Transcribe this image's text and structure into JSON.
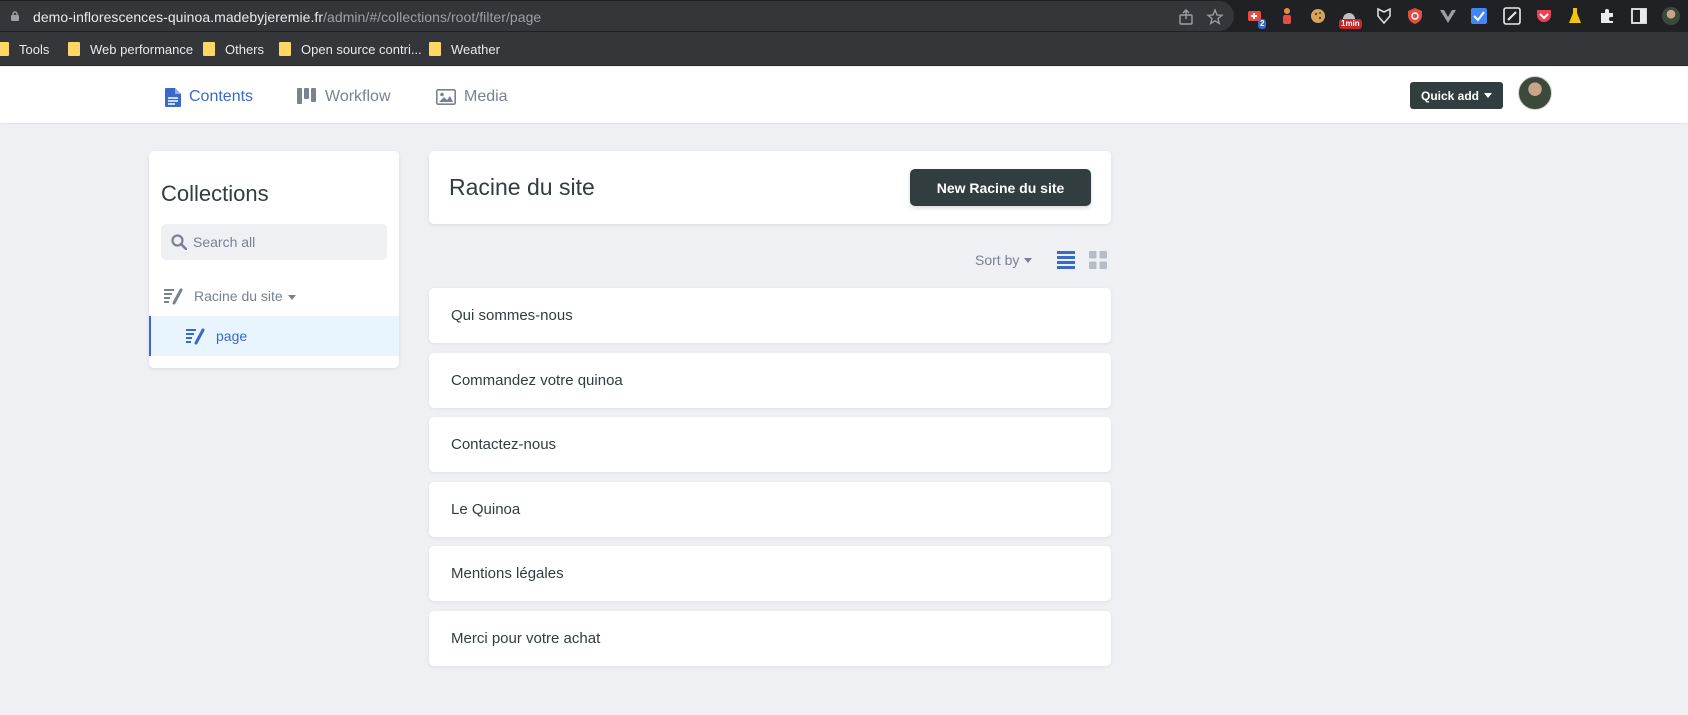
{
  "browser": {
    "url_host": "demo-inflorescences-quinoa.madebyjeremie.fr",
    "url_path": "/admin/#/collections/root/filter/page",
    "ext_badges": {
      "tab_count": "2",
      "timer": "1min"
    },
    "bookmarks": [
      "Tools",
      "Web performance",
      "Others",
      "Open source contri...",
      "Weather"
    ]
  },
  "header": {
    "nav": [
      {
        "label": "Contents",
        "icon": "document-icon",
        "active": true
      },
      {
        "label": "Workflow",
        "icon": "workflow-icon",
        "active": false
      },
      {
        "label": "Media",
        "icon": "image-icon",
        "active": false
      }
    ],
    "quick_add_label": "Quick add"
  },
  "sidebar": {
    "title": "Collections",
    "search_placeholder": "Search all",
    "collection": {
      "label": "Racine du site"
    },
    "filter": {
      "label": "page",
      "active": true
    }
  },
  "main": {
    "title": "Racine du site",
    "new_button_label": "New Racine du site",
    "sort_label": "Sort by",
    "view_mode": "list",
    "entries": [
      "Qui sommes-nous",
      "Commandez votre quinoa",
      "Contactez-nous",
      "Le Quinoa",
      "Mentions légales",
      "Merci pour votre achat"
    ]
  },
  "colors": {
    "accent": "#3a69c7",
    "dark_button": "#313d3e",
    "muted_text": "#798291",
    "page_bg": "#eff0f4",
    "active_item_bg": "#e8f5fe"
  }
}
